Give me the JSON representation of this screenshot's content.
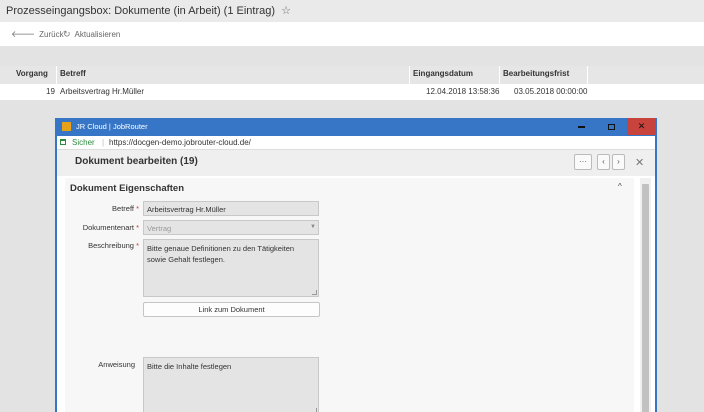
{
  "page": {
    "title": "Prozesseingangsbox: Dokumente (in Arbeit) (1 Eintrag)",
    "star_icon": "☆"
  },
  "toolbar": {
    "back_label": "Zurück",
    "back_icon": "🡐",
    "refresh_label": "Aktualisieren",
    "refresh_icon": "↻"
  },
  "grid": {
    "columns": [
      "Vorgang",
      "Betreff",
      "Eingangsdatum",
      "Bearbeitungsfrist"
    ],
    "rows": [
      {
        "vorgang": "19",
        "betreff": "Arbeitsvertrag Hr.Müller",
        "eingangsdatum": "12.04.2018 13:58:36",
        "frist": "03.05.2018 00:00:00"
      }
    ]
  },
  "window": {
    "title": "JR Cloud | JobRouter",
    "secure_label": "Sicher",
    "url": "https://docgen-demo.jobrouter-cloud.de/",
    "close_icon": "✕"
  },
  "dialog": {
    "title": "Dokument bearbeiten (19)",
    "more_icon": "···",
    "prev_icon": "‹",
    "next_icon": "›",
    "close_icon": "✕"
  },
  "form": {
    "section_title": "Dokument Eigenschaften",
    "collapse_icon": "^",
    "betreff": {
      "label": "Betreff",
      "value": "Arbeitsvertrag Hr.Müller"
    },
    "dokumentenart": {
      "label": "Dokumentenart",
      "value": "Vertrag"
    },
    "beschreibung": {
      "label": "Beschreibung",
      "value": "Bitte genaue Definitionen zu den Tätigkeiten sowie Gehalt festlegen."
    },
    "link_button": "Link zum Dokument",
    "anweisung": {
      "label": "Anweisung",
      "value": "Bitte die Inhalte festlegen"
    },
    "required_mark": "*"
  },
  "colors": {
    "window_blue": "#3776c6",
    "close_red": "#c8433b",
    "secure_green": "#2b8a3e"
  }
}
